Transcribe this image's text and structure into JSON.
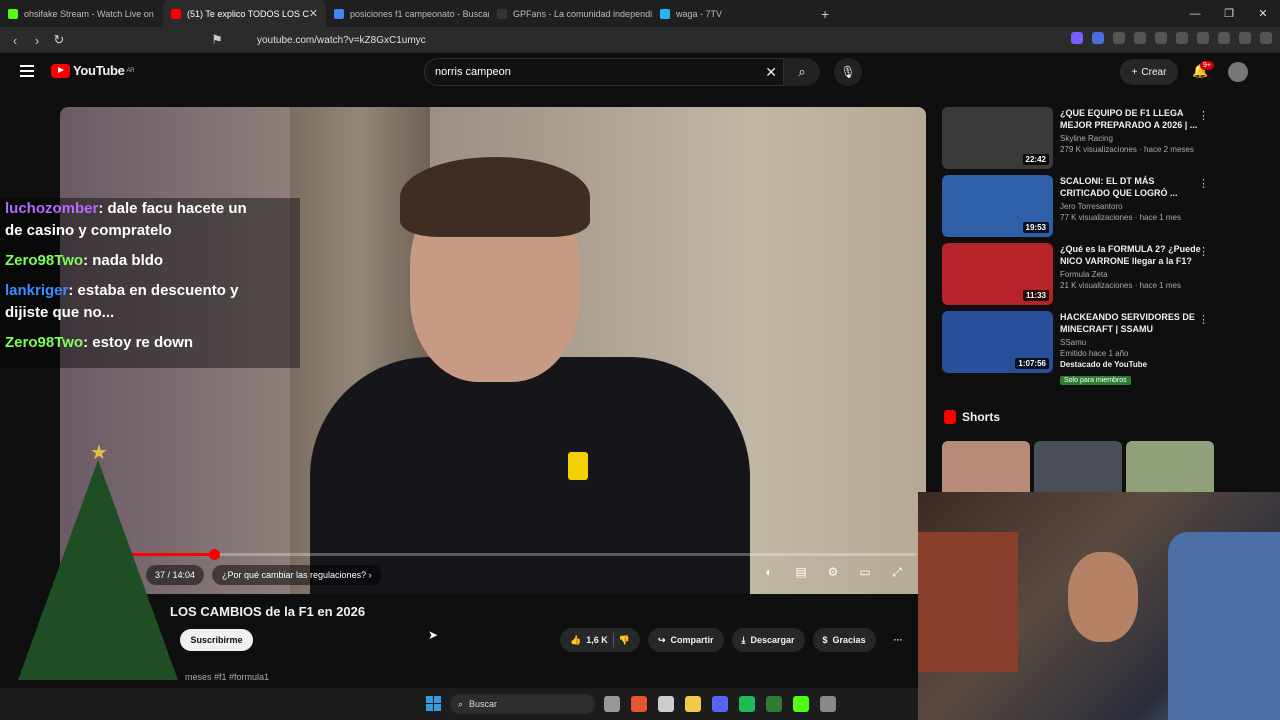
{
  "browser": {
    "tabs": [
      {
        "label": "ohsifake Stream - Watch Live on",
        "color": "#53fc18"
      },
      {
        "label": "(51) Te explico TODOS LOS C",
        "color": "#ff0000",
        "active": true
      },
      {
        "label": "posiciones f1 campeonato - Buscar c",
        "color": "#4285f4"
      },
      {
        "label": "GPFans - La comunidad independien",
        "color": "#333333"
      },
      {
        "label": "waga - 7TV",
        "color": "#29b6f6"
      }
    ],
    "new_tab": "+",
    "url": "youtube.com/watch?v=kZ8GxC1umyc"
  },
  "youtube": {
    "logo_text": "YouTube",
    "region": "AR",
    "search_value": "norris campeon",
    "create_label": "Crear",
    "notif_badge": "9+"
  },
  "player": {
    "time": "37 / 14:04",
    "chapter": "¿Por qué cambiar las regulaciones?",
    "progress_fraction": 0.17
  },
  "chat": [
    {
      "user": "luchozomber",
      "color": "#b46aff",
      "text": ": dale facu hacete un",
      "cont": "de casino y compratelo"
    },
    {
      "user": "Zero98Two",
      "color": "#7dff5a",
      "text": ": nada bldo"
    },
    {
      "user": "lankriger",
      "color": "#3d8bff",
      "text": ": estaba en descuento y",
      "cont": "dijiste que no..."
    },
    {
      "user": "Zero98Two",
      "color": "#7dff5a",
      "text": ": estoy re down"
    }
  ],
  "video": {
    "title": "LOS CAMBIOS de la F1 en 2026",
    "subscribe": "Suscribirme",
    "likes": "1,6 K",
    "share": "Compartir",
    "download": "Descargar",
    "thanks": "Gracias",
    "more": "···",
    "desc_age": "meses",
    "tags": "#f1 #formula1"
  },
  "related": [
    {
      "title": "¿QUE EQUIPO DE F1 LLEGA MEJOR PREPARADO A 2026 | ...",
      "channel": "Skyline Racing",
      "meta": "279 K visualizaciones · hace 2 meses",
      "duration": "22:42",
      "thumb": "#3a3a3a"
    },
    {
      "title": "SCALONI: EL DT MÁS CRITICADO QUE LOGRÓ ...",
      "channel": "Jero Torresantoro",
      "meta": "77 K visualizaciones · hace 1 mes",
      "duration": "19:53",
      "thumb": "#2f5fa8"
    },
    {
      "title": "¿Qué es la FORMULA 2? ¿Puede NICO VARRONE llegar a la F1?",
      "channel": "Formula Zeta",
      "meta": "21 K visualizaciones · hace 1 mes",
      "duration": "11:33",
      "thumb": "#b8232a"
    },
    {
      "title": "HACKEANDO SERVIDORES DE MINECRAFT | SSAMU",
      "channel": "SSamu",
      "meta": "Emitido hace 1 año",
      "duration": "1:07:56",
      "thumb": "#2a4f9a",
      "tagline": "Destacado de YouTube",
      "member": "Solo para miembros"
    }
  ],
  "shorts": {
    "heading": "Shorts",
    "items": [
      {
        "thumb": "#b88a7a"
      },
      {
        "thumb": "#4a4e57"
      },
      {
        "thumb": "#8fa07a"
      }
    ]
  },
  "taskbar": {
    "search_label": "Buscar",
    "icons": [
      "#999999",
      "#e4572e",
      "#cccccc",
      "#f2c94c",
      "#5865f2",
      "#1db954",
      "#2e7d32",
      "#53fc18",
      "#888888"
    ]
  }
}
